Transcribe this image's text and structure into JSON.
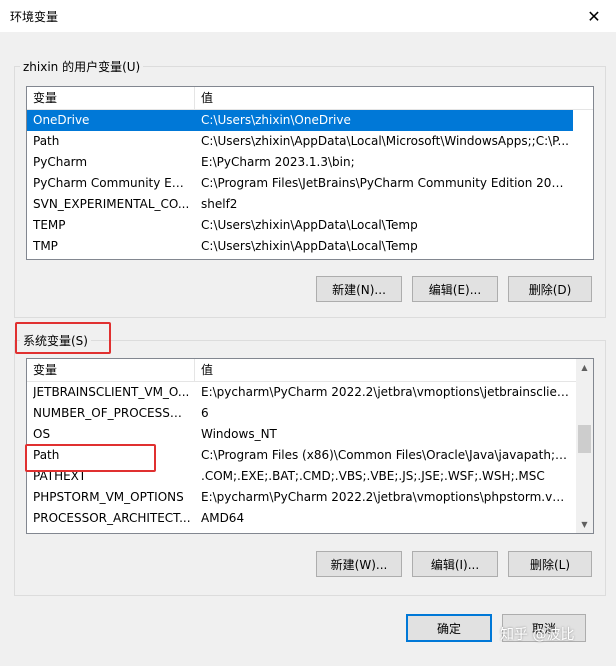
{
  "window": {
    "title": "环境变量",
    "close_glyph": "✕"
  },
  "user_vars": {
    "group_label": "zhixin 的用户变量(U)",
    "columns": [
      "变量",
      "值"
    ],
    "rows": [
      {
        "name": "OneDrive",
        "value": "C:\\Users\\zhixin\\OneDrive",
        "selected": true
      },
      {
        "name": "Path",
        "value": "C:\\Users\\zhixin\\AppData\\Local\\Microsoft\\WindowsApps;;C:\\P..."
      },
      {
        "name": "PyCharm",
        "value": "E:\\PyCharm 2023.1.3\\bin;"
      },
      {
        "name": "PyCharm Community Editi...",
        "value": "C:\\Program Files\\JetBrains\\PyCharm Community Edition 2023...."
      },
      {
        "name": "SVN_EXPERIMENTAL_CO...",
        "value": "shelf2"
      },
      {
        "name": "TEMP",
        "value": "C:\\Users\\zhixin\\AppData\\Local\\Temp"
      },
      {
        "name": "TMP",
        "value": "C:\\Users\\zhixin\\AppData\\Local\\Temp"
      }
    ],
    "buttons": {
      "new": "新建(N)...",
      "edit": "编辑(E)...",
      "delete": "删除(D)"
    }
  },
  "system_vars": {
    "group_label": "系统变量(S)",
    "columns": [
      "变量",
      "值"
    ],
    "rows": [
      {
        "name": "JETBRAINSCLIENT_VM_O...",
        "value": "E:\\pycharm\\PyCharm 2022.2\\jetbra\\vmoptions\\jetbrainsclient...."
      },
      {
        "name": "NUMBER_OF_PROCESSORS",
        "value": "6"
      },
      {
        "name": "OS",
        "value": "Windows_NT"
      },
      {
        "name": "Path",
        "value": "C:\\Program Files (x86)\\Common Files\\Oracle\\Java\\javapath;C:..."
      },
      {
        "name": "PATHEXT",
        "value": ".COM;.EXE;.BAT;.CMD;.VBS;.VBE;.JS;.JSE;.WSF;.WSH;.MSC"
      },
      {
        "name": "PHPSTORM_VM_OPTIONS",
        "value": "E:\\pycharm\\PyCharm 2022.2\\jetbra\\vmoptions\\phpstorm.vm..."
      },
      {
        "name": "PROCESSOR_ARCHITECT...",
        "value": "AMD64"
      }
    ],
    "buttons": {
      "new": "新建(W)...",
      "edit": "编辑(I)...",
      "delete": "删除(L)"
    }
  },
  "dialog_buttons": {
    "ok": "确定",
    "cancel": "取消"
  },
  "watermark": "知乎 @波比",
  "colors": {
    "selection": "#0078d7",
    "highlight_box": "#e03030",
    "default_button_border": "#0078d7"
  }
}
